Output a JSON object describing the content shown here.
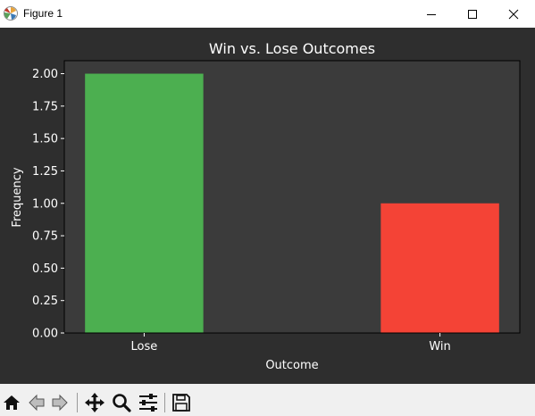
{
  "window": {
    "title": "Figure 1",
    "icons": [
      "matplotlib-app-icon",
      "minimize-icon",
      "maximize-icon",
      "close-icon"
    ]
  },
  "chart_data": {
    "type": "bar",
    "title": "Win vs. Lose Outcomes",
    "xlabel": "Outcome",
    "ylabel": "Frequency",
    "categories": [
      "Lose",
      "Win"
    ],
    "values": [
      2,
      1
    ],
    "bar_colors": [
      "#4caf50",
      "#f44336"
    ],
    "ylim": [
      0,
      2.1
    ],
    "yticks": [
      "0.00",
      "0.25",
      "0.50",
      "0.75",
      "1.00",
      "1.25",
      "1.50",
      "1.75",
      "2.00"
    ],
    "ytick_values": [
      0,
      0.25,
      0.5,
      0.75,
      1.0,
      1.25,
      1.5,
      1.75,
      2.0
    ],
    "grid": false,
    "colors": {
      "figure_background": "#2e2e2e",
      "axes_background": "#3b3b3b",
      "text": "#ffffff"
    }
  },
  "toolbar": {
    "buttons": [
      "home-icon",
      "back-icon",
      "forward-icon",
      "pan-icon",
      "zoom-icon",
      "configure-subplots-icon",
      "save-icon"
    ]
  }
}
